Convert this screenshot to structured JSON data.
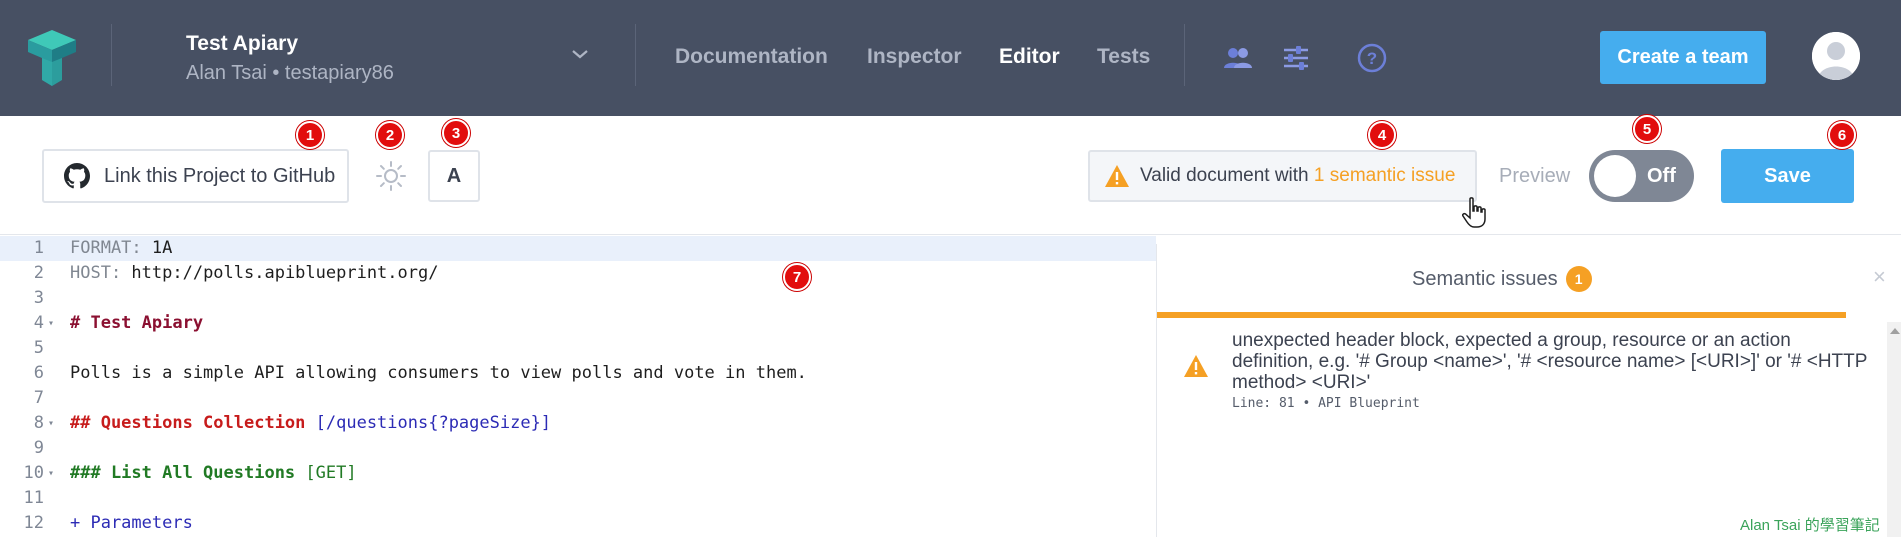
{
  "header": {
    "project_name": "Test Apiary",
    "project_owner": "Alan Tsai • testapiary86",
    "nav": [
      {
        "label": "Documentation",
        "active": false
      },
      {
        "label": "Inspector",
        "active": false
      },
      {
        "label": "Editor",
        "active": true
      },
      {
        "label": "Tests",
        "active": false
      }
    ],
    "icons": [
      "team-icon",
      "settings-sliders-icon",
      "help-icon"
    ],
    "create_team_label": "Create a team"
  },
  "toolbar": {
    "github_label": "Link this Project to GitHub",
    "font_label": "A",
    "validation_prefix": "Valid document with ",
    "validation_issue": "1 semantic issue",
    "preview_label": "Preview",
    "toggle_label": "Off",
    "save_label": "Save"
  },
  "callouts": [
    "1",
    "2",
    "3",
    "4",
    "5",
    "6",
    "7"
  ],
  "editor": {
    "active_line": 1,
    "lines": [
      {
        "n": "1",
        "fold": false,
        "key": "FORMAT: ",
        "val": "1A"
      },
      {
        "n": "2",
        "fold": false,
        "key": "HOST: ",
        "val": "http://polls.apiblueprint.org/"
      },
      {
        "n": "3",
        "fold": false
      },
      {
        "n": "4",
        "fold": true,
        "h1": "# Test Apiary"
      },
      {
        "n": "5",
        "fold": false
      },
      {
        "n": "6",
        "fold": false,
        "text": "Polls is a simple API allowing consumers to view polls and vote in them."
      },
      {
        "n": "7",
        "fold": false
      },
      {
        "n": "8",
        "fold": true,
        "h2": "## Questions Collection ",
        "h2u": "[/questions{?pageSize}]"
      },
      {
        "n": "9",
        "fold": false
      },
      {
        "n": "10",
        "fold": true,
        "h3": "### List All Questions ",
        "h3m": "[GET]"
      },
      {
        "n": "11",
        "fold": false
      },
      {
        "n": "12",
        "fold": false,
        "list": "+ Parameters"
      }
    ]
  },
  "issues_panel": {
    "title": "Semantic issues",
    "count": "1",
    "close": "×",
    "issues": [
      {
        "severity": "warning",
        "message": "unexpected header block, expected a group, resource or an action definition, e.g. '# Group <name>', '# <resource name> [<URI>]' or '# <HTTP method> <URI>'",
        "meta": "Line: 81 • API Blueprint"
      }
    ]
  },
  "watermark": "Alan Tsai 的學習筆記",
  "colors": {
    "header_bg": "#475063",
    "accent_blue": "#45adee",
    "warning_orange": "#f5a024",
    "callout_red": "#e20d0d"
  }
}
